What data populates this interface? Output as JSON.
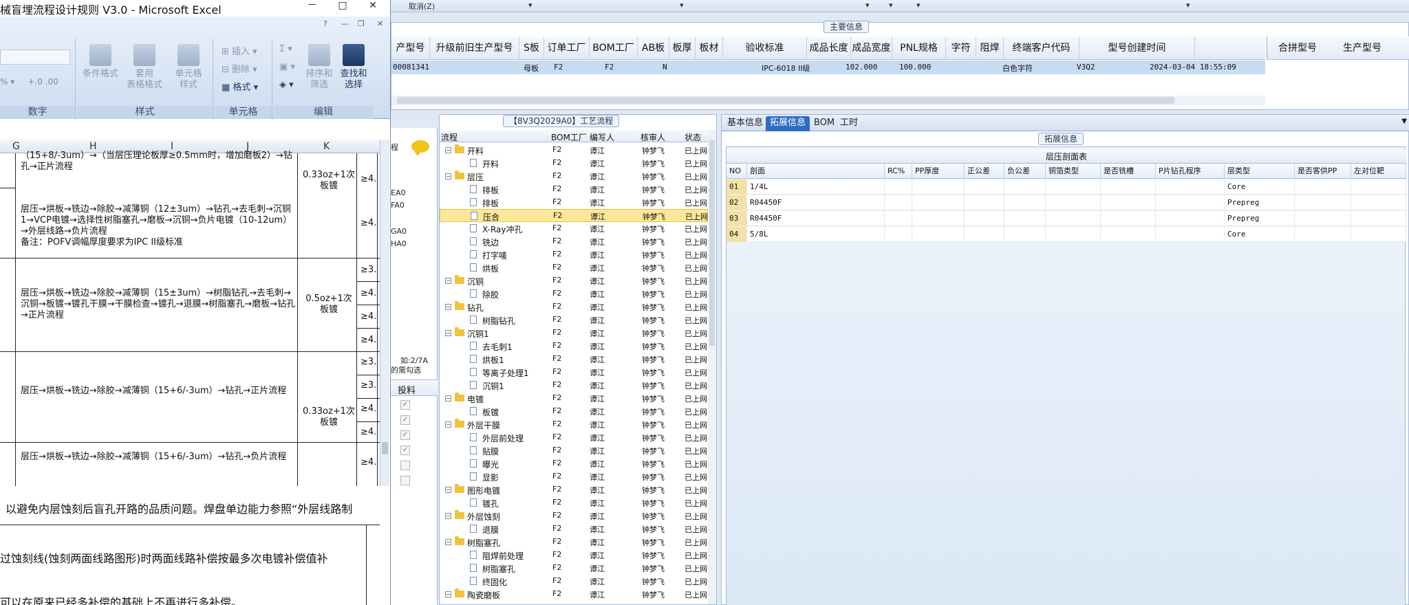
{
  "excel": {
    "title": "械盲埋流程设计规则 V3.0 - Microsoft Excel",
    "window_buttons": [
      "－",
      "□",
      "✕"
    ],
    "ribbon": {
      "groups": [
        {
          "name": "数字"
        },
        {
          "name": "样式",
          "buttons": [
            "条件格式",
            "套用\n表格格式",
            "单元格\n样式"
          ]
        },
        {
          "name": "单元格",
          "buttons": [
            "插入",
            "删除",
            "格式"
          ]
        },
        {
          "name": "编辑",
          "buttons": [
            "排序和\n筛选",
            "查找和\n选择"
          ]
        }
      ],
      "sum_symbol": "Σ",
      "percent": "% ▾",
      "decimal": "+.0 .00"
    },
    "columns": [
      "G",
      "H",
      "I",
      "J",
      "K"
    ],
    "rows": [
      {
        "process": "（15+8/-3um）→（当层压理论板厚≥0.5mm时，增加磨板2）→钻孔→正片流程",
        "copper": "0.33oz+1次板镀",
        "req": "≥4."
      },
      {
        "process": "层压→烘板→铣边→除胶→减薄铜（12±3um）→钻孔→去毛刺→沉铜1→VCP电镀→选择性树脂塞孔→磨板→沉铜→负片电镀（10-12um）→外层线路→负片流程\n备注：POFV调幅厚度要求为IPC II级标准",
        "copper": "",
        "req": "≥4."
      },
      {
        "process": "层压→烘板→铣边→除胶→减薄铜（15±3um）→树脂钻孔→去毛刺→沉铜→板镀→镀孔干膜→干膜检查→镀孔→退膜→树脂塞孔→磨板→钻孔→正片流程",
        "copper": "0.5oz+1次板镀",
        "req": [
          "≥3.",
          "≥4.",
          "≥4.",
          "≥4."
        ]
      },
      {
        "process": "层压→烘板→铣边→除胶→减薄铜（15+6/-3um）→钻孔→正片流程",
        "copper": "0.33oz+1次板镀",
        "req": [
          "≥3.",
          "≥3.",
          "≥4.",
          "≥4."
        ]
      },
      {
        "process": "层压→烘板→铣边→除胶→减薄铜（15+6/-3um）→钻孔→负片流程",
        "copper": "",
        "req": "≥4."
      }
    ],
    "notes": [
      "以避免内层蚀刻后盲孔开路的品质问题。焊盘单边能力参照“外层线路制",
      "过蚀刻线(蚀刻两面线路图形)时两面线路补偿按最多次电镀补偿值补",
      "可以在原来已经多补偿的基础上不再进行多补偿。"
    ]
  },
  "erp": {
    "toolbar": {
      "undo_label": "取消(Z)"
    },
    "main_info": {
      "caption": "主要信息",
      "columns": [
        "产型号",
        "升级前旧生产型号",
        "S板",
        "订单工厂",
        "BOM工厂",
        "AB板",
        "板厚",
        "板材",
        "验收标准",
        "成品长度",
        "成品宽度",
        "PNL规格",
        "字符",
        "阻焊",
        "终端客户代码",
        "型号创建时间"
      ],
      "side_columns": [
        "合拼型号",
        "生产型号"
      ],
      "row": {
        "model": "00081341",
        "s_board": "母板",
        "order_factory": "F2",
        "bom_factory": "F2",
        "ab_board": "N",
        "acceptance": "IPC-6018 II级",
        "length": "102.000",
        "width": "100.000",
        "char": "白色字符",
        "customer": "V3Q2",
        "created": "2024-03-04 18:55:09"
      }
    },
    "side_list": {
      "items": [
        "EA0",
        "FA0",
        "GA0",
        "HA0"
      ],
      "hint1": "如:2/7A",
      "hint2": "的需勾选",
      "col_header": "投料",
      "checks": [
        true,
        true,
        true,
        true,
        false,
        false
      ]
    },
    "process": {
      "caption": "【8V3Q2029A0】工艺流程",
      "columns": [
        "流程",
        "BOM工厂",
        "编写人",
        "核审人",
        "状态"
      ],
      "rows": [
        {
          "name": "开料",
          "type": "folder",
          "factory": "F2",
          "writer": "谭江",
          "reviewer": "钟梦飞",
          "status": "已上网"
        },
        {
          "name": "开料",
          "type": "doc",
          "factory": "F2",
          "writer": "谭江",
          "reviewer": "钟梦飞",
          "status": "已上网"
        },
        {
          "name": "层压",
          "type": "folder",
          "factory": "F2",
          "writer": "谭江",
          "reviewer": "钟梦飞",
          "status": "已上网"
        },
        {
          "name": "排板",
          "type": "doc",
          "factory": "F2",
          "writer": "谭江",
          "reviewer": "钟梦飞",
          "status": "已上网"
        },
        {
          "name": "排板",
          "type": "doc",
          "factory": "F2",
          "writer": "谭江",
          "reviewer": "钟梦飞",
          "status": "已上网"
        },
        {
          "name": "压合",
          "type": "doc",
          "factory": "F2",
          "writer": "谭江",
          "reviewer": "钟梦飞",
          "status": "已上网",
          "selected": true
        },
        {
          "name": "X-Ray冲孔",
          "type": "doc",
          "factory": "F2",
          "writer": "谭江",
          "reviewer": "钟梦飞",
          "status": "已上网"
        },
        {
          "name": "铣边",
          "type": "doc",
          "factory": "F2",
          "writer": "谭江",
          "reviewer": "钟梦飞",
          "status": "已上网"
        },
        {
          "name": "打字唛",
          "type": "doc",
          "factory": "F2",
          "writer": "谭江",
          "reviewer": "钟梦飞",
          "status": "已上网"
        },
        {
          "name": "烘板",
          "type": "doc",
          "factory": "F2",
          "writer": "谭江",
          "reviewer": "钟梦飞",
          "status": "已上网"
        },
        {
          "name": "沉铜",
          "type": "folder",
          "factory": "F2",
          "writer": "谭江",
          "reviewer": "钟梦飞",
          "status": "已上网"
        },
        {
          "name": "除胶",
          "type": "doc",
          "factory": "F2",
          "writer": "谭江",
          "reviewer": "钟梦飞",
          "status": "已上网"
        },
        {
          "name": "钻孔",
          "type": "folder",
          "factory": "F2",
          "writer": "谭江",
          "reviewer": "钟梦飞",
          "status": "已上网"
        },
        {
          "name": "树脂钻孔",
          "type": "doc",
          "factory": "F2",
          "writer": "谭江",
          "reviewer": "钟梦飞",
          "status": "已上网"
        },
        {
          "name": "沉铜1",
          "type": "folder",
          "factory": "F2",
          "writer": "谭江",
          "reviewer": "钟梦飞",
          "status": "已上网"
        },
        {
          "name": "去毛刺1",
          "type": "doc",
          "factory": "F2",
          "writer": "谭江",
          "reviewer": "钟梦飞",
          "status": "已上网"
        },
        {
          "name": "烘板1",
          "type": "doc",
          "factory": "F2",
          "writer": "谭江",
          "reviewer": "钟梦飞",
          "status": "已上网"
        },
        {
          "name": "等离子处理1",
          "type": "doc",
          "factory": "F2",
          "writer": "谭江",
          "reviewer": "钟梦飞",
          "status": "已上网"
        },
        {
          "name": "沉铜1",
          "type": "doc",
          "factory": "F2",
          "writer": "谭江",
          "reviewer": "钟梦飞",
          "status": "已上网"
        },
        {
          "name": "电镀",
          "type": "folder",
          "factory": "F2",
          "writer": "谭江",
          "reviewer": "钟梦飞",
          "status": "已上网"
        },
        {
          "name": "板镀",
          "type": "doc",
          "factory": "F2",
          "writer": "谭江",
          "reviewer": "钟梦飞",
          "status": "已上网"
        },
        {
          "name": "外层干膜",
          "type": "folder",
          "factory": "F2",
          "writer": "谭江",
          "reviewer": "钟梦飞",
          "status": "已上网"
        },
        {
          "name": "外层前处理",
          "type": "doc",
          "factory": "F2",
          "writer": "谭江",
          "reviewer": "钟梦飞",
          "status": "已上网"
        },
        {
          "name": "贴膜",
          "type": "doc",
          "factory": "F2",
          "writer": "谭江",
          "reviewer": "钟梦飞",
          "status": "已上网"
        },
        {
          "name": "曝光",
          "type": "doc",
          "factory": "F2",
          "writer": "谭江",
          "reviewer": "钟梦飞",
          "status": "已上网"
        },
        {
          "name": "显影",
          "type": "doc",
          "factory": "F2",
          "writer": "谭江",
          "reviewer": "钟梦飞",
          "status": "已上网"
        },
        {
          "name": "图形电镀",
          "type": "folder",
          "factory": "F2",
          "writer": "谭江",
          "reviewer": "钟梦飞",
          "status": "已上网"
        },
        {
          "name": "镀孔",
          "type": "doc",
          "factory": "F2",
          "writer": "谭江",
          "reviewer": "钟梦飞",
          "status": "已上网"
        },
        {
          "name": "外层蚀刻",
          "type": "folder",
          "factory": "F2",
          "writer": "谭江",
          "reviewer": "钟梦飞",
          "status": "已上网"
        },
        {
          "name": "退膜",
          "type": "doc",
          "factory": "F2",
          "writer": "谭江",
          "reviewer": "钟梦飞",
          "status": "已上网"
        },
        {
          "name": "树脂塞孔",
          "type": "folder",
          "factory": "F2",
          "writer": "谭江",
          "reviewer": "钟梦飞",
          "status": "已上网"
        },
        {
          "name": "阻焊前处理",
          "type": "doc",
          "factory": "F2",
          "writer": "谭江",
          "reviewer": "钟梦飞",
          "status": "已上网"
        },
        {
          "name": "树脂塞孔",
          "type": "doc",
          "factory": "F2",
          "writer": "谭江",
          "reviewer": "钟梦飞",
          "status": "已上网"
        },
        {
          "name": "终固化",
          "type": "doc",
          "factory": "F2",
          "writer": "谭江",
          "reviewer": "钟梦飞",
          "status": "已上网"
        },
        {
          "name": "陶瓷磨板",
          "type": "folder",
          "factory": "F2",
          "writer": "谭江",
          "reviewer": "钟梦飞",
          "status": "已上网"
        }
      ]
    },
    "detail": {
      "tabs": [
        "基本信息",
        "拓展信息",
        "BOM",
        "工时"
      ],
      "active_tab": 1,
      "caption": "拓展信息",
      "table_title": "层压剖面表",
      "columns": [
        "NO",
        "剖面",
        "RC%",
        "PP厚度",
        "正公差",
        "负公差",
        "铜箔类型",
        "是否铣槽",
        "P片钻孔程序",
        "层类型",
        "是否客供PP",
        "左对位靶"
      ],
      "rows": [
        {
          "no": "01",
          "section": "1/4L",
          "layer_type": "Core"
        },
        {
          "no": "02",
          "section": "R04450F",
          "layer_type": "Prepreg"
        },
        {
          "no": "03",
          "section": "R04450F",
          "layer_type": "Prepreg"
        },
        {
          "no": "04",
          "section": "5/8L",
          "layer_type": "Core"
        }
      ]
    },
    "colors": {
      "accent": "#2f6bc2",
      "selection": "#fde89a",
      "row_highlight": "#c7dcf3"
    }
  }
}
